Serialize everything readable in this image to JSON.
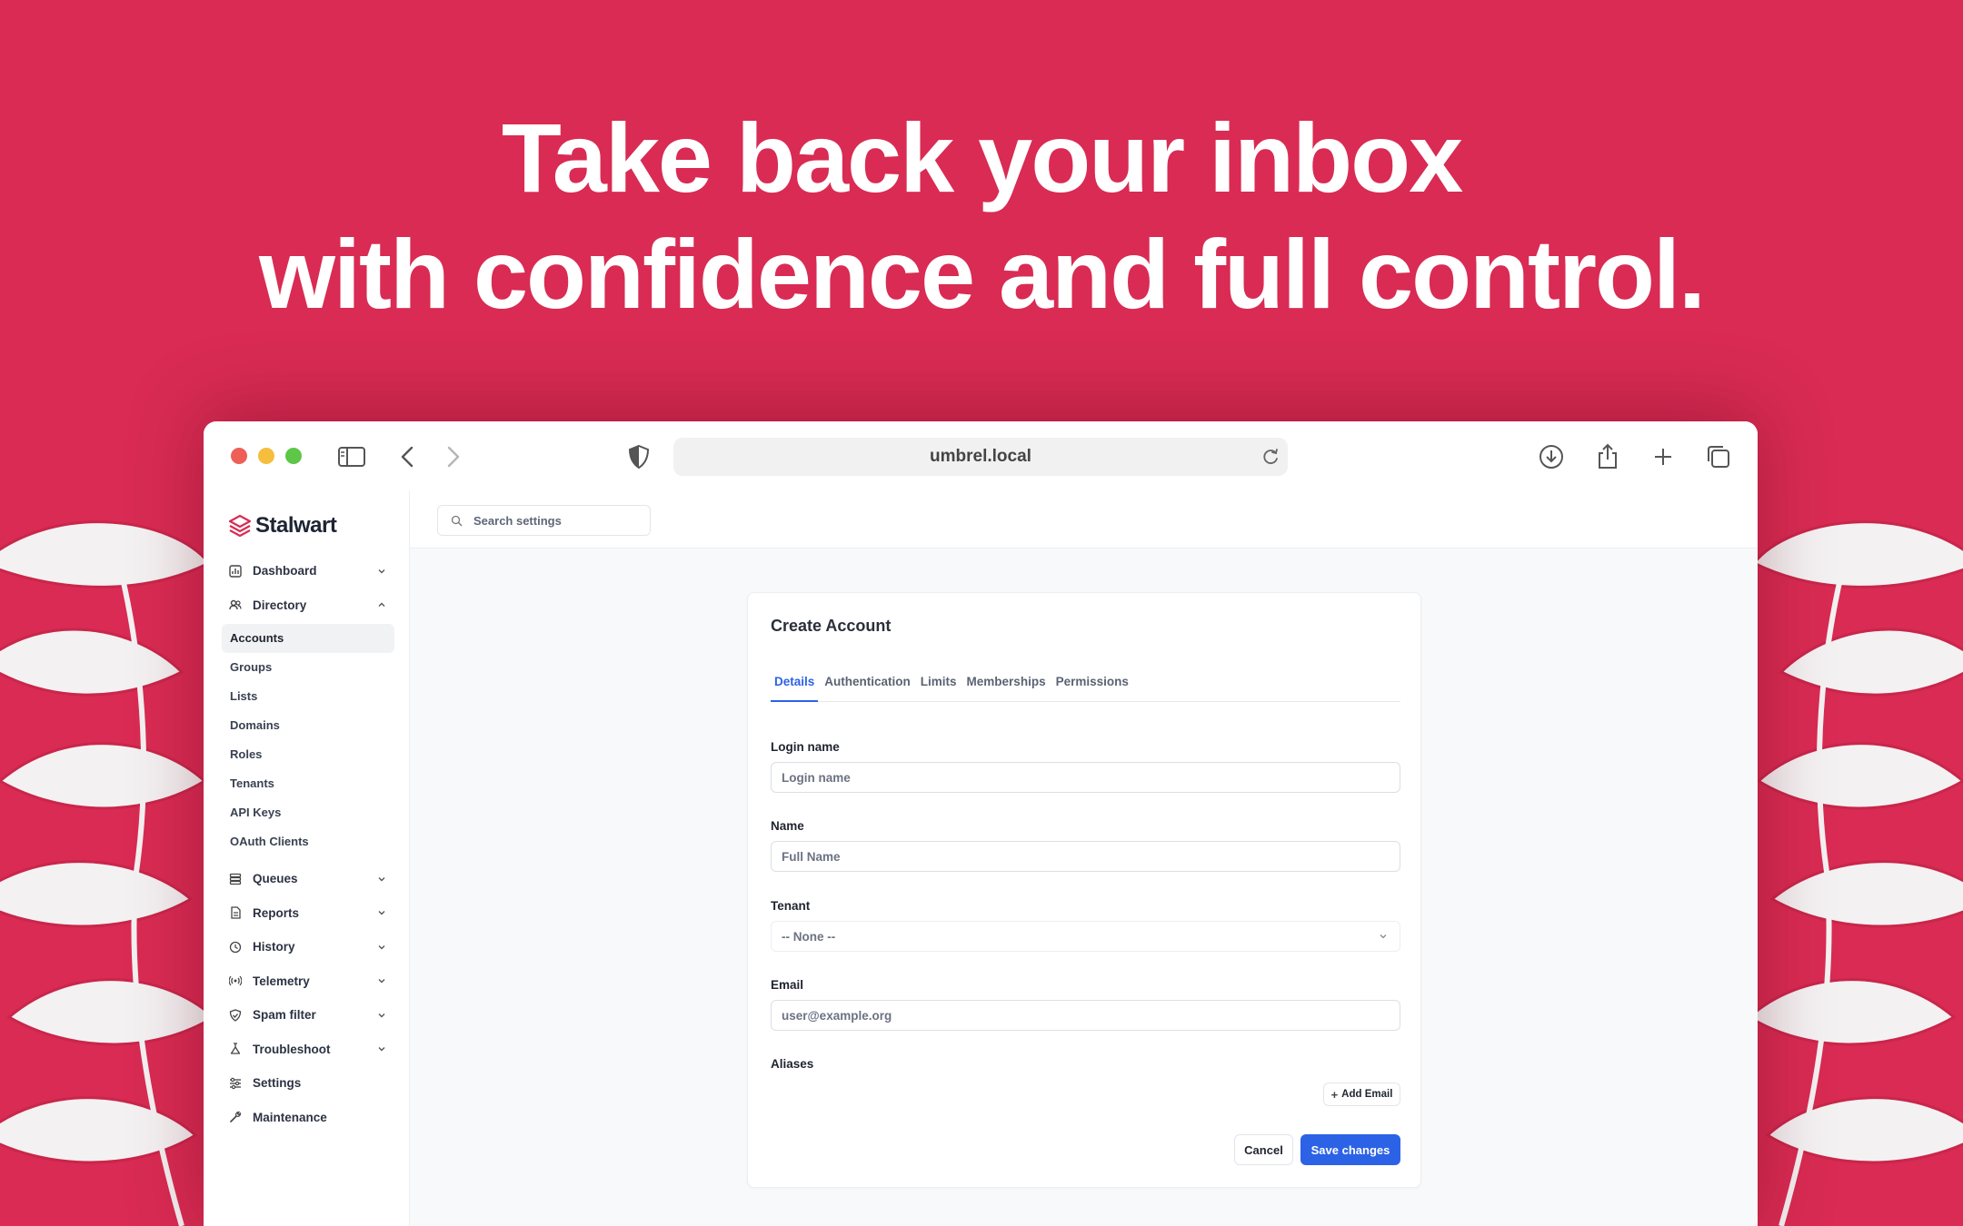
{
  "headline": {
    "line1": "Take back your inbox",
    "line2": "with confidence and full control."
  },
  "browser": {
    "url": "umbrel.local",
    "icons": [
      "sidebar-toggle-icon",
      "back-icon",
      "forward-icon",
      "shield-icon",
      "reload-icon",
      "download-icon",
      "share-icon",
      "new-tab-icon",
      "tabs-overview-icon"
    ]
  },
  "app": {
    "brand": "Stalwart",
    "search_placeholder": "Search settings",
    "sidebar": {
      "dashboard": "Dashboard",
      "directory": "Directory",
      "directory_items": [
        "Accounts",
        "Groups",
        "Lists",
        "Domains",
        "Roles",
        "Tenants",
        "API Keys",
        "OAuth Clients"
      ],
      "queues": "Queues",
      "reports": "Reports",
      "history": "History",
      "telemetry": "Telemetry",
      "spam_filter": "Spam filter",
      "troubleshoot": "Troubleshoot",
      "settings": "Settings",
      "maintenance": "Maintenance"
    },
    "form": {
      "title": "Create Account",
      "tabs": [
        "Details",
        "Authentication",
        "Limits",
        "Memberships",
        "Permissions"
      ],
      "active_tab": "Details",
      "login_label": "Login name",
      "login_placeholder": "Login name",
      "name_label": "Name",
      "name_placeholder": "Full Name",
      "tenant_label": "Tenant",
      "tenant_value": "-- None --",
      "email_label": "Email",
      "email_placeholder": "user@example.org",
      "aliases_label": "Aliases",
      "add_email": "Add Email",
      "cancel": "Cancel",
      "save": "Save changes"
    }
  },
  "colors": {
    "background": "#d92b53",
    "accent": "#2c62e6"
  }
}
